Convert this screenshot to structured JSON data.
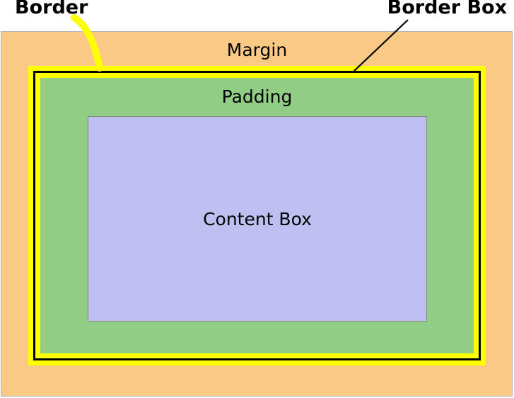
{
  "labels": {
    "border_callout": "Border",
    "border_box_callout": "Border Box",
    "margin": "Margin",
    "padding": "Padding",
    "content": "Content Box"
  },
  "colors": {
    "margin_fill": "#fac986",
    "border_fill": "#ffff00",
    "border_stroke": "#000000",
    "padding_fill": "#92cd86",
    "content_fill": "#bec0f2"
  }
}
